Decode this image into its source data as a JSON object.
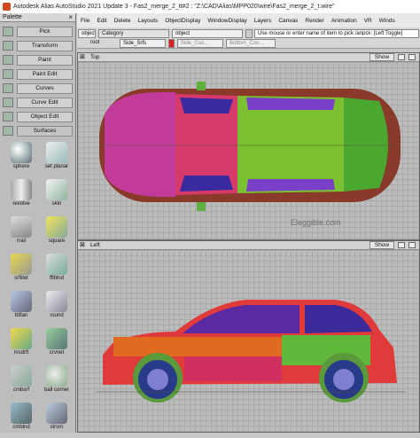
{
  "window": {
    "title": "Autodesk Alias AutoStudio 2021 Update 3   - Fas2_merge_2_tt#2 : \"Z:\\CAD\\Alias\\MPP020\\wire\\Fas2_merge_2_t.wire\""
  },
  "palette": {
    "title": "Palette",
    "close": "×",
    "buttons": [
      "Pick",
      "Transform",
      "Paint",
      "Paint Edit",
      "Curves",
      "Curve Edit",
      "Object Edit"
    ],
    "section": "Surfaces",
    "tools": [
      "sphere",
      "set planar",
      "revolve",
      "skin",
      "rrail",
      "square",
      "srfillet",
      "fflblnd",
      "tbflan",
      "round",
      "msdrft",
      "crvnet",
      "cmbsrf",
      "ball corner",
      "cmblnd",
      "strsrn"
    ]
  },
  "menubar": {
    "items": [
      "File",
      "Edit",
      "Delete",
      "Layouts",
      "ObjectDisplay",
      "WindowDisplay",
      "Layers",
      "Canvas",
      "Render",
      "Animation",
      "VR",
      "Winds"
    ]
  },
  "toolbar": {
    "object_label": "object",
    "category_label": "Category",
    "object_field": "object",
    "prompt": "Use mouse or enter name of item to pick /anpck: [Left Toggle]",
    "root_label": "root",
    "layers": [
      "Side_Srfs",
      "Side_Coo...",
      "Bottom_Coo..."
    ]
  },
  "views": {
    "top": {
      "label": "Top",
      "show": "Show"
    },
    "left": {
      "label": "Left",
      "show": "Show"
    }
  },
  "watermark": "Eleggible.com",
  "colors": {
    "accent": "#d04a1e",
    "grid": "#bcbcbc"
  }
}
